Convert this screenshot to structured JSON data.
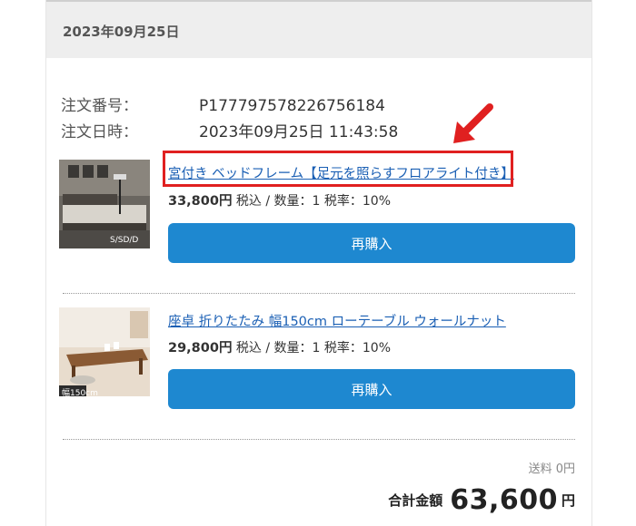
{
  "order_date_header": "2023年09月25日",
  "order_meta": {
    "number_label": "注文番号：",
    "number_value": "P177797578226756184",
    "date_label": "注文日時：",
    "date_value": "2023年09月25日 11:43:58"
  },
  "items": [
    {
      "title": "宮付き ベッドフレーム【足元を照らすフロアライト付き】",
      "price": "33,800円",
      "price_suffix": " 税込 / 数量：1 税率：10%",
      "rebuy_label": "再購入",
      "thumb_text": "S/SD/D"
    },
    {
      "title": "座卓 折りたたみ 幅150cm ローテーブル ウォールナット",
      "price": "29,800円",
      "price_suffix": " 税込 / 数量：1 税率：10%",
      "rebuy_label": "再購入",
      "thumb_text": "幅150cm"
    }
  ],
  "shipping": "送料 0円",
  "total": {
    "label": "合計金額",
    "amount": "63,600",
    "unit": "円"
  },
  "colors": {
    "button": "#1e88d0",
    "link": "#1a5fb4",
    "highlight": "#e02020"
  }
}
